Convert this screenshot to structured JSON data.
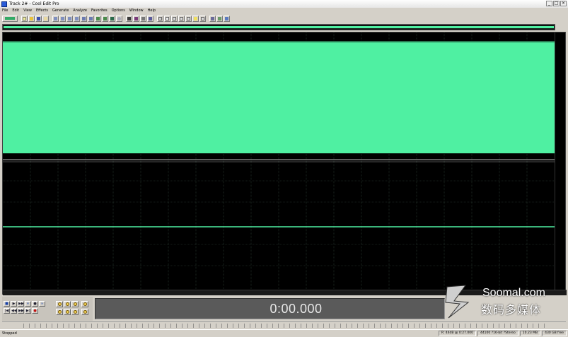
{
  "window": {
    "title": "Track 2# - Cool Edit Pro",
    "controls": [
      "_",
      "□",
      "×"
    ]
  },
  "menus": [
    "File",
    "Edit",
    "View",
    "Effects",
    "Generate",
    "Analyze",
    "Favorites",
    "Options",
    "Window",
    "Help"
  ],
  "transport": {
    "row1": [
      "■",
      "▶",
      "▶▶",
      "⏸",
      "●",
      "∞"
    ],
    "row2": [
      "|◀",
      "◀◀",
      "▶▶",
      "▶|",
      "●"
    ],
    "time_display": "0:00.000"
  },
  "watermark": {
    "line1": "Soomal.com",
    "line2": "数码多媒体"
  },
  "statusbar": {
    "status": "Stopped",
    "fields": [
      "R: 44dB @ 0:27.000",
      "44100 ?16-bit ?Stereo",
      "10.23 MB",
      "430 GB free"
    ]
  },
  "colors": {
    "waveform": "#4ff0a2",
    "background": "#000000",
    "grid": "#2b3b33",
    "chrome": "#d4d0c8"
  }
}
